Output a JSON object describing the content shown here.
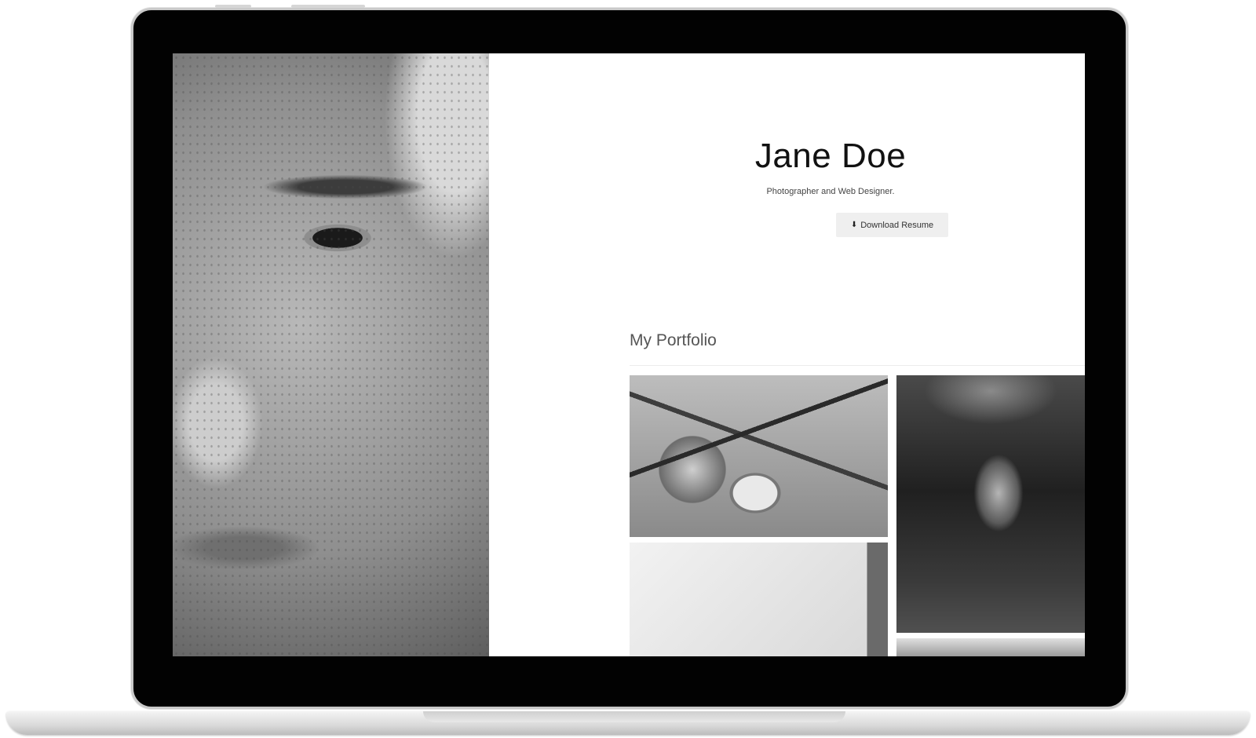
{
  "profile": {
    "name": "Jane Doe",
    "tagline": "Photographer and Web Designer.",
    "resume_button": "Download Resume"
  },
  "portfolio": {
    "title": "My Portfolio"
  },
  "icons": {
    "download": "download-icon"
  }
}
